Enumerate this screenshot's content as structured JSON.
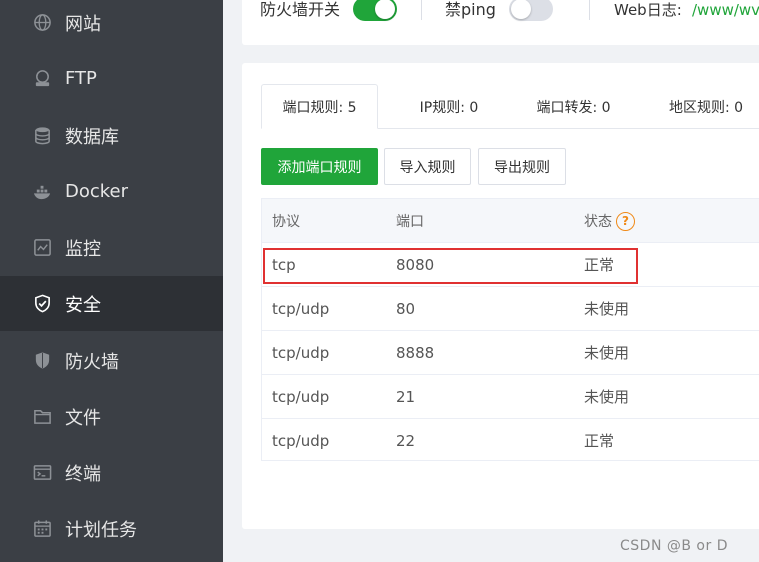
{
  "sidebar": {
    "items": [
      {
        "label": "网站",
        "icon": "globe-icon"
      },
      {
        "label": "FTP",
        "icon": "ftp-icon"
      },
      {
        "label": "数据库",
        "icon": "database-icon"
      },
      {
        "label": "Docker",
        "icon": "docker-icon"
      },
      {
        "label": "监控",
        "icon": "monitor-icon"
      },
      {
        "label": "安全",
        "icon": "shield-check-icon",
        "active": true
      },
      {
        "label": "防火墙",
        "icon": "shield-icon"
      },
      {
        "label": "文件",
        "icon": "folder-icon"
      },
      {
        "label": "终端",
        "icon": "terminal-icon"
      },
      {
        "label": "计划任务",
        "icon": "calendar-icon"
      }
    ]
  },
  "topbar": {
    "firewall_label": "防火墙开关",
    "firewall_on": true,
    "ping_label": "禁ping",
    "ping_on": false,
    "weblog_label": "Web日志:",
    "weblog_value": "/www/wv"
  },
  "tabs": [
    {
      "label": "端口规则: 5",
      "active": true
    },
    {
      "label": "IP规则: 0"
    },
    {
      "label": "端口转发: 0"
    },
    {
      "label": "地区规则: 0"
    }
  ],
  "buttons": {
    "add": "添加端口规则",
    "import": "导入规则",
    "export": "导出规则"
  },
  "table": {
    "headers": [
      "协议",
      "端口",
      "状态"
    ],
    "rows": [
      [
        "tcp",
        "8080",
        "正常"
      ],
      [
        "tcp/udp",
        "80",
        "未使用"
      ],
      [
        "tcp/udp",
        "8888",
        "未使用"
      ],
      [
        "tcp/udp",
        "21",
        "未使用"
      ],
      [
        "tcp/udp",
        "22",
        "正常"
      ]
    ]
  },
  "watermark": "CSDN @B    or    D",
  "colors": {
    "accent": "#20a53a",
    "sidebar_bg": "#3b3f45",
    "highlight": "#e03131",
    "help": "#f08a18"
  }
}
